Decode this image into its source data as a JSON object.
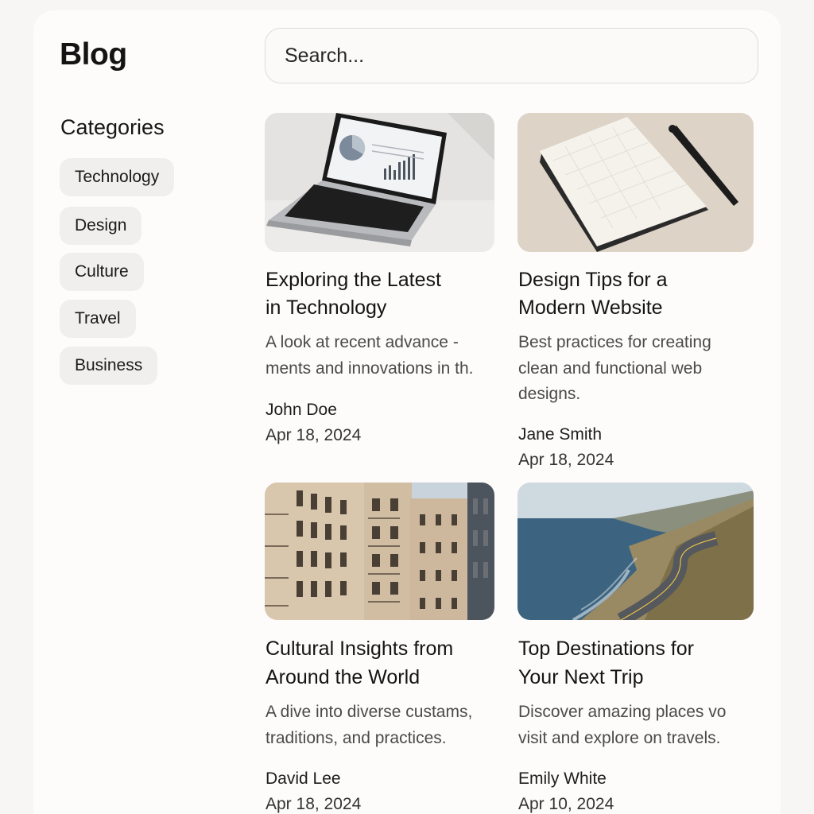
{
  "header": {
    "title": "Blog"
  },
  "search": {
    "placeholder": "Search..."
  },
  "sidebar": {
    "heading": "Categories",
    "categories": [
      {
        "label": "Technology"
      },
      {
        "label": "Design"
      },
      {
        "label": "Culture"
      },
      {
        "label": "Travel"
      },
      {
        "label": "Business"
      }
    ]
  },
  "posts": [
    {
      "title_line1": "Exploring the Latest",
      "title_line2": "in Technology",
      "desc_line1": "A look at recent advance -",
      "desc_line2": "ments and innovations in th.",
      "desc_line3": "",
      "author": "John Doe",
      "date": "Apr 18, 2024",
      "image": "laptop-with-charts"
    },
    {
      "title_line1": "Design Tips for a",
      "title_line2": "Modern Website",
      "desc_line1": "Best practices for creating",
      "desc_line2": "clean and functional web",
      "desc_line3": "designs.",
      "author": "Jane Smith",
      "date": "Apr 18, 2024",
      "image": "notebook-and-pen"
    },
    {
      "title_line1": "Cultural Insights from",
      "title_line2": "Around the World",
      "desc_line1": "A dive into diverse custams,",
      "desc_line2": "traditions, and practices.",
      "desc_line3": "",
      "author": "David Lee",
      "date": "Apr 18, 2024",
      "image": "city-buildings"
    },
    {
      "title_line1": "Top Destinations for",
      "title_line2": "Your Next Trip",
      "desc_line1": "Discover amazing places vo",
      "desc_line2": "visit and explore on travels.",
      "desc_line3": "",
      "author": "Emily White",
      "date": "Apr 10, 2024",
      "image": "coastal-road"
    }
  ],
  "colors": {
    "background": "#f7f6f4",
    "panel": "#fdfcfb",
    "chip": "#f0efed",
    "text": "#141414",
    "muted": "#4a4a4a"
  }
}
